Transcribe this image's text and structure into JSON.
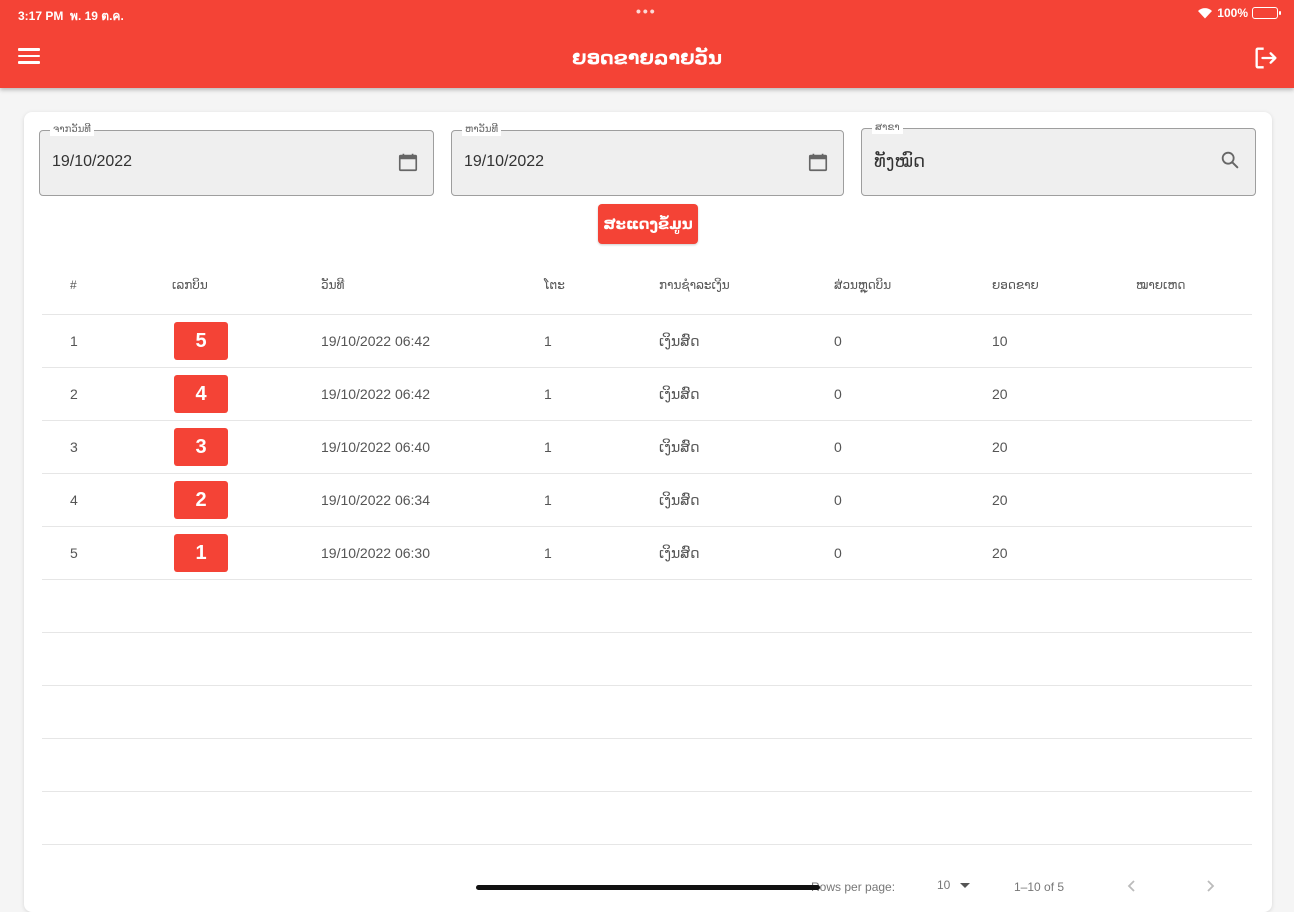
{
  "status_bar": {
    "time": "3:17 PM",
    "date": "พ. 19 ต.ค.",
    "battery": "100%"
  },
  "app_bar": {
    "title": "ຍອດຂາຍລາຍວັນ",
    "menu_icon": "hamburger-menu-icon",
    "logout_icon": "logout-icon"
  },
  "filters": {
    "from_date": {
      "label": "ຈາກວັນທີ",
      "value": "19/10/2022",
      "icon": "calendar-icon"
    },
    "to_date": {
      "label": "ຫາວັນທີ",
      "value": "19/10/2022",
      "icon": "calendar-icon"
    },
    "branch": {
      "label": "ສາຂາ",
      "value": "ທັງໝົດ",
      "icon": "search-icon"
    },
    "show_button": "ສະແດງຂໍ້ມູນ"
  },
  "table": {
    "columns": [
      "#",
      "ເລກບິນ",
      "ວັນທີ",
      "ໂຕະ",
      "ການຊໍາລະເງິນ",
      "ສ່ວນຫຼຸດບິນ",
      "ຍອດຂາຍ",
      "ໝາຍເຫດ"
    ],
    "rows": [
      {
        "no": "1",
        "bill": "5",
        "date": "19/10/2022 06:42",
        "table": "1",
        "payment": "ເງິນສົດ",
        "discount": "0",
        "total": "10",
        "note": ""
      },
      {
        "no": "2",
        "bill": "4",
        "date": "19/10/2022 06:42",
        "table": "1",
        "payment": "ເງິນສົດ",
        "discount": "0",
        "total": "20",
        "note": ""
      },
      {
        "no": "3",
        "bill": "3",
        "date": "19/10/2022 06:40",
        "table": "1",
        "payment": "ເງິນສົດ",
        "discount": "0",
        "total": "20",
        "note": ""
      },
      {
        "no": "4",
        "bill": "2",
        "date": "19/10/2022 06:34",
        "table": "1",
        "payment": "ເງິນສົດ",
        "discount": "0",
        "total": "20",
        "note": ""
      },
      {
        "no": "5",
        "bill": "1",
        "date": "19/10/2022 06:30",
        "table": "1",
        "payment": "ເງິນສົດ",
        "discount": "0",
        "total": "20",
        "note": ""
      }
    ],
    "empty_rows": 5
  },
  "pagination": {
    "rows_per_page_label": "Rows per page:",
    "rows_per_page": "10",
    "range": "1–10 of 5",
    "prev_icon": "chevron-left-icon",
    "next_icon": "chevron-right-icon"
  },
  "colors": {
    "primary": "#f44336",
    "field_bg": "#efefef",
    "page_bg": "#f5f5f5"
  }
}
